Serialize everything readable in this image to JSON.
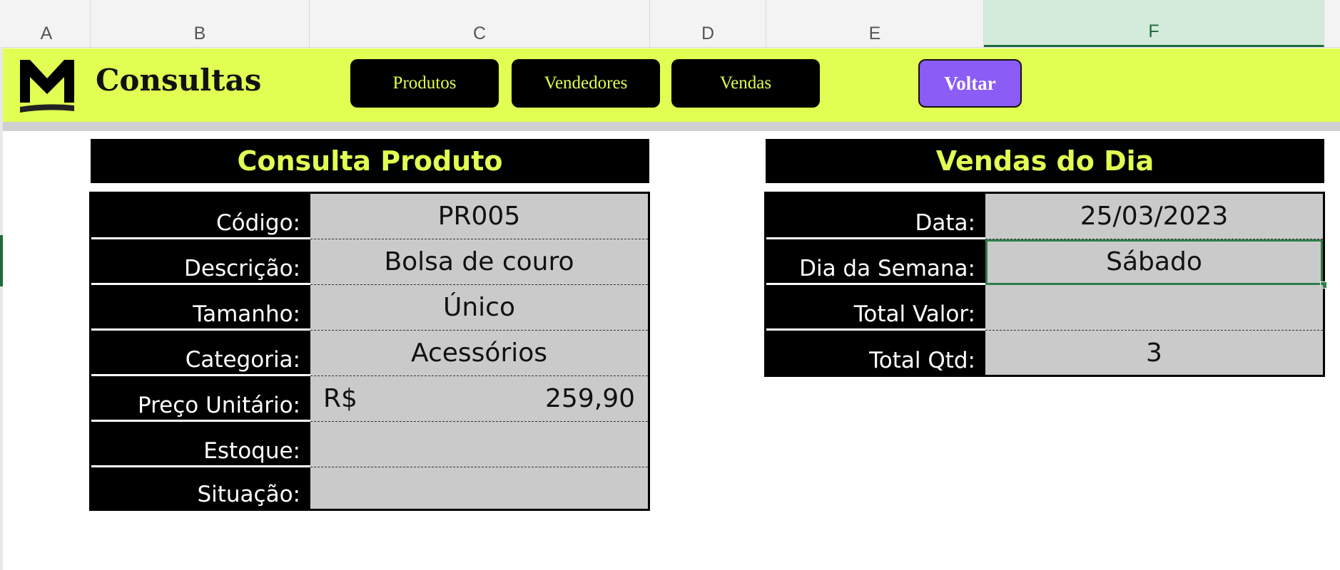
{
  "column_headers": [
    "A",
    "B",
    "C",
    "D",
    "E",
    "F"
  ],
  "active_column": "F",
  "banner": {
    "title": "Consultas",
    "buttons": [
      "Produtos",
      "Vendedores",
      "Vendas"
    ],
    "back_label": "Voltar",
    "accent_color": "#e1ff52",
    "back_color": "#8b5cf6"
  },
  "produto": {
    "title": "Consulta Produto",
    "fields": [
      {
        "label": "Código:",
        "value": "PR005"
      },
      {
        "label": "Descrição:",
        "value": "Bolsa de couro"
      },
      {
        "label": "Tamanho:",
        "value": "Único"
      },
      {
        "label": "Categoria:",
        "value": "Acessórios"
      },
      {
        "label": "Preço Unitário:",
        "currency": "R$",
        "value": "259,90"
      },
      {
        "label": "Estoque:",
        "value": ""
      },
      {
        "label": "Situação:",
        "value": ""
      }
    ]
  },
  "vendas": {
    "title": "Vendas do Dia",
    "fields": [
      {
        "label": "Data:",
        "value": "25/03/2023"
      },
      {
        "label": "Dia da Semana:",
        "value": "Sábado"
      },
      {
        "label": "Total Valor:",
        "value": ""
      },
      {
        "label": "Total Qtd:",
        "value": "3"
      }
    ]
  }
}
